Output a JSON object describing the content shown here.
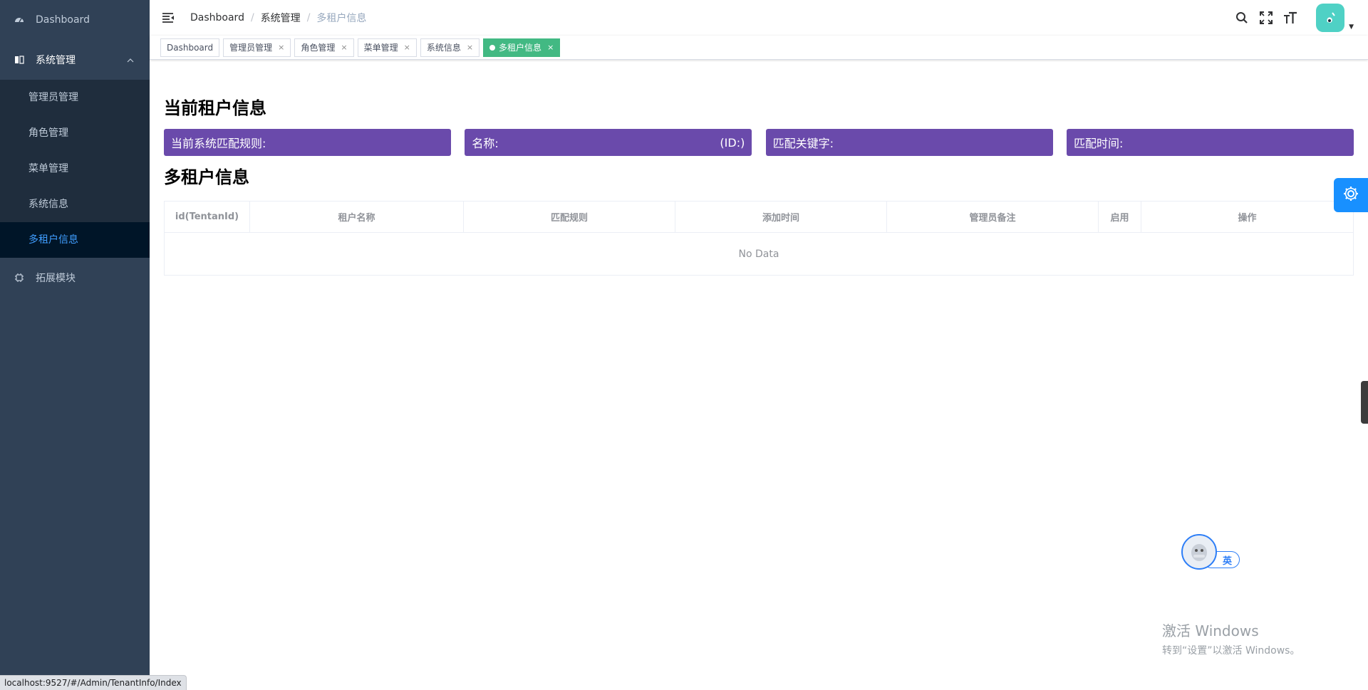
{
  "sidebar": {
    "items": [
      {
        "label": "Dashboard",
        "icon": "dashboard-icon"
      },
      {
        "label": "系统管理",
        "icon": "book-icon",
        "expanded": true,
        "children": [
          "管理员管理",
          "角色管理",
          "菜单管理",
          "系统信息",
          "多租户信息"
        ],
        "active_child": "多租户信息"
      },
      {
        "label": "拓展模块",
        "icon": "chip-icon"
      }
    ]
  },
  "navbar": {
    "breadcrumb": [
      "Dashboard",
      "系统管理",
      "多租户信息"
    ],
    "icons": [
      "search-icon",
      "fullscreen-icon",
      "font-size-icon"
    ]
  },
  "tags": [
    {
      "label": "Dashboard",
      "closable": false,
      "active": false
    },
    {
      "label": "管理员管理",
      "closable": true,
      "active": false
    },
    {
      "label": "角色管理",
      "closable": true,
      "active": false
    },
    {
      "label": "菜单管理",
      "closable": true,
      "active": false
    },
    {
      "label": "系统信息",
      "closable": true,
      "active": false
    },
    {
      "label": "多租户信息",
      "closable": true,
      "active": true
    }
  ],
  "content": {
    "current_title": "当前租户信息",
    "info": {
      "rule_label": "当前系统匹配规则:",
      "name_label": "名称:",
      "id_label": "(ID:)",
      "keyword_label": "匹配关键字:",
      "time_label": "匹配时间:"
    },
    "multi_title": "多租户信息",
    "table": {
      "columns": [
        "id(TentanId)",
        "租户名称",
        "匹配规则",
        "添加时间",
        "管理员备注",
        "启用",
        "操作"
      ],
      "rows": [],
      "empty_text": "No Data"
    }
  },
  "ime": {
    "mode": "英"
  },
  "watermark": {
    "line1": "激活 Windows",
    "line2": "转到“设置”以激活 Windows。"
  },
  "statusbar": {
    "url": "localhost:9527/#/Admin/TenantInfo/Index"
  },
  "colors": {
    "sidebar_bg": "#304156",
    "submenu_bg": "#1f2d3d",
    "active_menu_text": "#409eff",
    "active_tag": "#42b983",
    "info_box": "#6a4aab",
    "settings_btn": "#1890ff"
  }
}
